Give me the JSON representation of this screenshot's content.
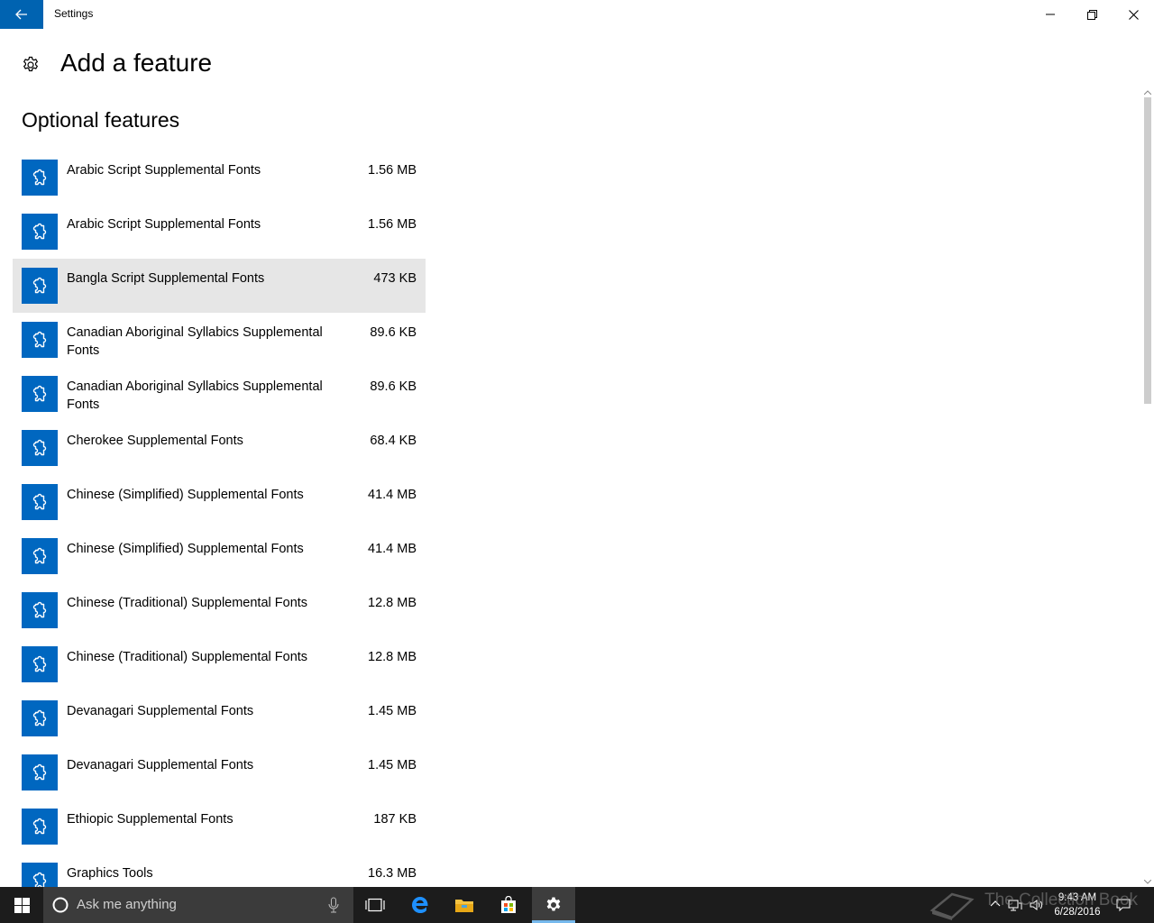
{
  "window": {
    "title": "Settings"
  },
  "header": {
    "title": "Add a feature"
  },
  "section": {
    "title": "Optional features"
  },
  "features": [
    {
      "name": "Arabic Script Supplemental Fonts",
      "size": "1.56 MB"
    },
    {
      "name": "Arabic Script Supplemental Fonts",
      "size": "1.56 MB"
    },
    {
      "name": "Bangla Script Supplemental Fonts",
      "size": "473 KB",
      "selected": true
    },
    {
      "name": "Canadian Aboriginal Syllabics Supplemental Fonts",
      "size": "89.6 KB"
    },
    {
      "name": "Canadian Aboriginal Syllabics Supplemental Fonts",
      "size": "89.6 KB"
    },
    {
      "name": "Cherokee Supplemental Fonts",
      "size": "68.4 KB"
    },
    {
      "name": "Chinese (Simplified) Supplemental Fonts",
      "size": "41.4 MB"
    },
    {
      "name": "Chinese (Simplified) Supplemental Fonts",
      "size": "41.4 MB"
    },
    {
      "name": "Chinese (Traditional) Supplemental Fonts",
      "size": "12.8 MB"
    },
    {
      "name": "Chinese (Traditional) Supplemental Fonts",
      "size": "12.8 MB"
    },
    {
      "name": "Devanagari Supplemental Fonts",
      "size": "1.45 MB"
    },
    {
      "name": "Devanagari Supplemental Fonts",
      "size": "1.45 MB"
    },
    {
      "name": "Ethiopic Supplemental Fonts",
      "size": "187 KB"
    },
    {
      "name": "Graphics Tools",
      "size": "16.3 MB"
    }
  ],
  "taskbar": {
    "search_placeholder": "Ask me anything",
    "time": "9:43 AM",
    "date": "6/28/2016"
  },
  "watermark": {
    "text": "The Collection Book"
  },
  "colors": {
    "accent": "#0063b1",
    "icon_bg": "#0067c0",
    "taskbar": "#1c1c1c",
    "selected_row": "#e6e6e6"
  }
}
